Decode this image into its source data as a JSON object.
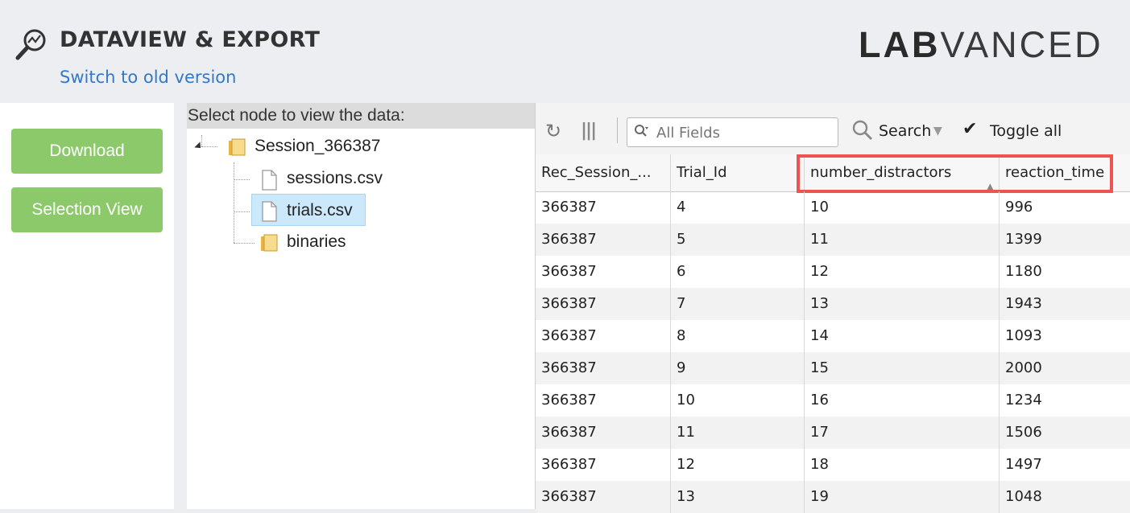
{
  "header": {
    "title": "DATAVIEW & EXPORT",
    "switch_link": "Switch to old version",
    "brand_bold": "LAB",
    "brand_light": "VANCED",
    "icon": "magnifier-chart-icon"
  },
  "sidebar": {
    "download_label": "Download",
    "selection_view_label": "Selection View",
    "button_color": "#8cc96b"
  },
  "tree": {
    "heading": "Select node to view the data:",
    "root": {
      "label": "Session_366387",
      "icon": "folder-icon"
    },
    "children": [
      {
        "label": "sessions.csv",
        "icon": "file-icon"
      },
      {
        "label": "trials.csv",
        "icon": "file-icon",
        "selected": true
      },
      {
        "label": "binaries",
        "icon": "folder-icon"
      }
    ]
  },
  "toolbar": {
    "filter_placeholder": "All Fields",
    "search_label": "Search",
    "toggle_all_label": "Toggle all"
  },
  "table": {
    "columns": [
      "Rec_Session_...",
      "Trial_Id",
      "number_distractors",
      "reaction_time"
    ],
    "sorted_column": "number_distractors",
    "sort_direction": "ascending",
    "highlight_color": "#ef5350",
    "rows": [
      [
        "366387",
        "4",
        "10",
        "996"
      ],
      [
        "366387",
        "5",
        "11",
        "1399"
      ],
      [
        "366387",
        "6",
        "12",
        "1180"
      ],
      [
        "366387",
        "7",
        "13",
        "1943"
      ],
      [
        "366387",
        "8",
        "14",
        "1093"
      ],
      [
        "366387",
        "9",
        "15",
        "2000"
      ],
      [
        "366387",
        "10",
        "16",
        "1234"
      ],
      [
        "366387",
        "11",
        "17",
        "1506"
      ],
      [
        "366387",
        "12",
        "18",
        "1497"
      ],
      [
        "366387",
        "13",
        "19",
        "1048"
      ]
    ]
  }
}
